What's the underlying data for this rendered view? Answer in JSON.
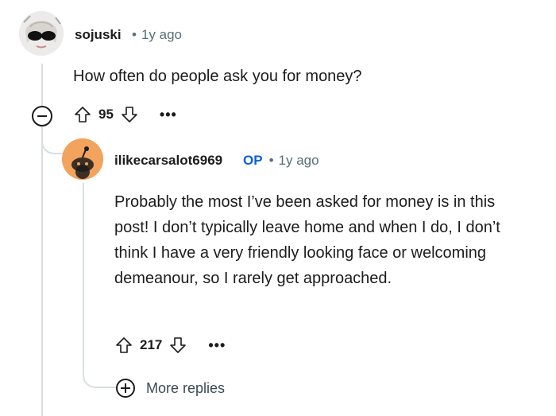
{
  "comment": {
    "username": "sojuski",
    "age": "1y ago",
    "text": "How often do people ask you for money?",
    "score": "95",
    "more_label": "•••"
  },
  "reply": {
    "username": "ilikecarsalot6969",
    "op_badge": "OP",
    "age": "1y ago",
    "text": "Probably the most I’ve been asked for money is in this post! I don’t typically leave home and when I do, I don’t think I have a very friendly looking face or welcoming demeanour, so I rarely get approached.",
    "score": "217",
    "more_label": "•••"
  },
  "more_replies": {
    "label": "More replies"
  },
  "colors": {
    "op_accent": "#0b62d6",
    "reply_avatar_bg": "#f2a35d",
    "thread_line": "#d9dee1"
  }
}
